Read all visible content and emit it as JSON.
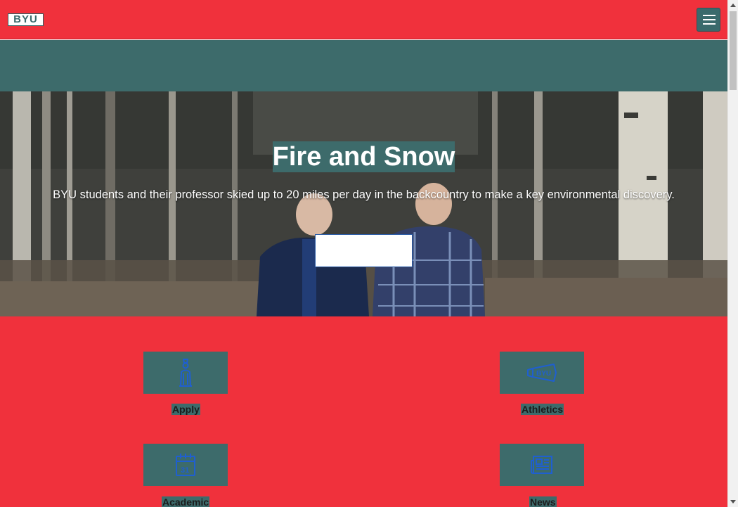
{
  "header": {
    "logo_text": "BYU",
    "menu_icon": "hamburger-menu-icon"
  },
  "hero": {
    "title": "Fire and Snow",
    "description": "BYU students and their professor skied up to 20 miles per day in the backcountry to make a key environmental discovery.",
    "button_label": ""
  },
  "quick_links": [
    {
      "label": "Apply",
      "icon": "graduate-figure-icon"
    },
    {
      "label": "Athletics",
      "icon": "byu-megaphone-icon"
    },
    {
      "label": "Academic",
      "icon": "calendar-icon"
    },
    {
      "label": "News",
      "icon": "newspaper-icon"
    }
  ],
  "colors": {
    "brand_red": "#f0313c",
    "teal": "#3d6b6b",
    "icon_blue": "#1f5fd1"
  }
}
